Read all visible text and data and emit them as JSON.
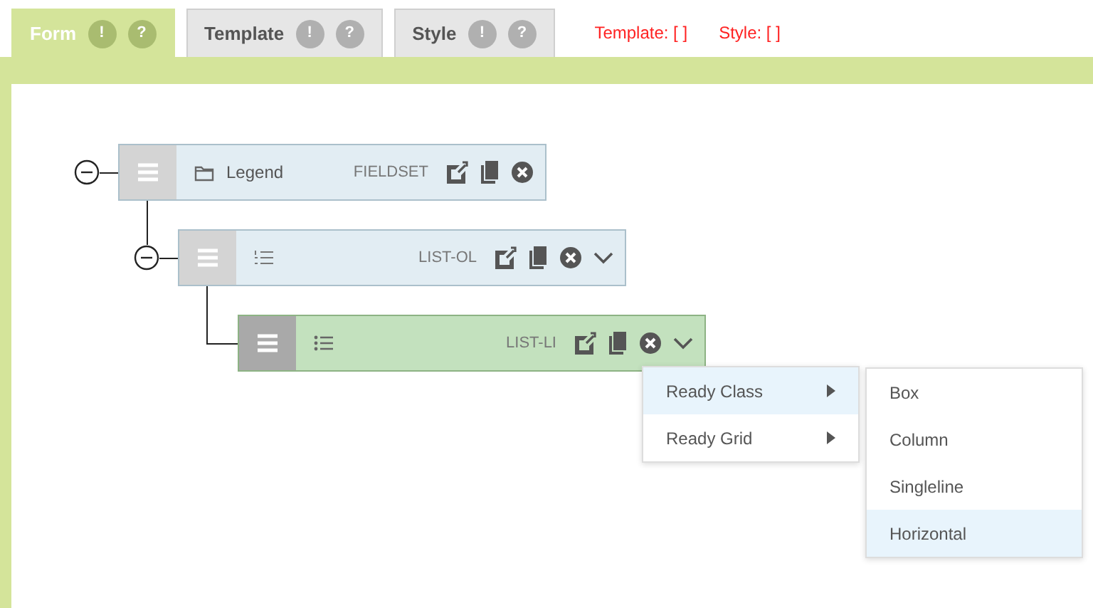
{
  "tabs": [
    {
      "label": "Form",
      "selected": true,
      "badges": [
        "!",
        "?"
      ]
    },
    {
      "label": "Template",
      "selected": false,
      "badges": [
        "!",
        "?"
      ]
    },
    {
      "label": "Style",
      "selected": false,
      "badges": [
        "!",
        "?"
      ]
    }
  ],
  "status": [
    "Template: [  ]",
    "Style: [  ]"
  ],
  "tree": [
    {
      "kind": "folder",
      "label": "Legend",
      "type": "FIELDSET",
      "selected": false,
      "menu_toggle": false,
      "children": [
        {
          "kind": "ordered-list",
          "type": "LIST-OL",
          "selected": false,
          "menu_toggle": true,
          "children": [
            {
              "kind": "unordered-list",
              "type": "LIST-LI",
              "selected": true,
              "menu_toggle": true
            }
          ]
        }
      ]
    }
  ],
  "menu": [
    {
      "label": "Ready Class",
      "selected": true,
      "submenu": true
    },
    {
      "label": "Ready Grid",
      "selected": false,
      "submenu": true
    }
  ],
  "submenu": [
    {
      "label": "Box",
      "selected": false
    },
    {
      "label": "Column",
      "selected": false
    },
    {
      "label": "Singleline",
      "selected": false
    },
    {
      "label": "Horizontal",
      "selected": true
    }
  ]
}
